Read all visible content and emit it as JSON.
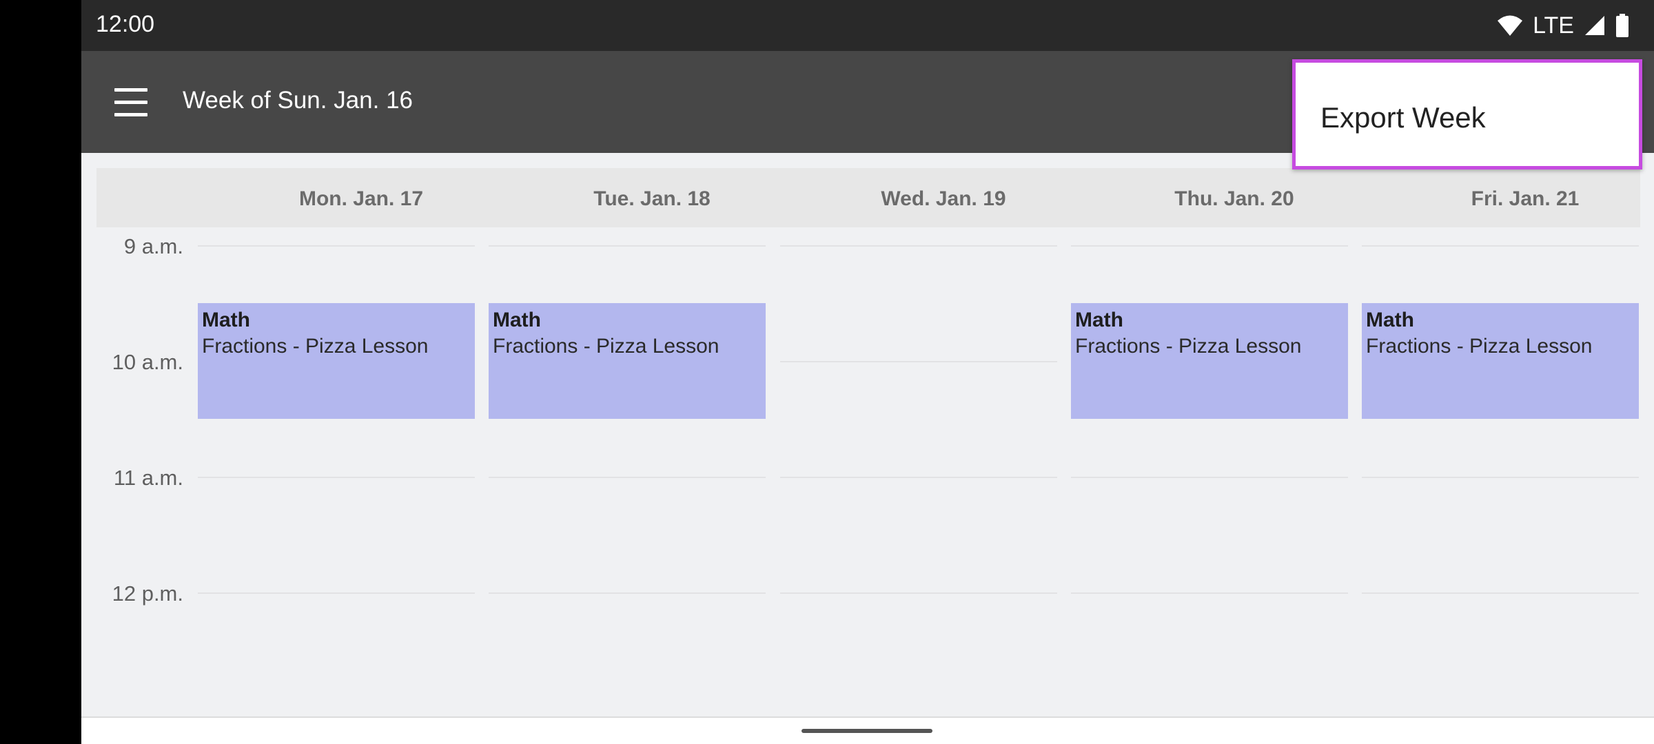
{
  "status_bar": {
    "time": "12:00",
    "network": "LTE",
    "icons": [
      "wifi-icon",
      "signal-icon",
      "battery-icon"
    ]
  },
  "toolbar": {
    "title": "Week of Sun. Jan. 16",
    "menu_icon": "hamburger-menu-icon"
  },
  "overflow_menu": {
    "items": [
      {
        "label": "Export Week"
      }
    ]
  },
  "days": [
    {
      "label": "Mon. Jan. 17"
    },
    {
      "label": "Tue. Jan. 18"
    },
    {
      "label": "Wed. Jan. 19"
    },
    {
      "label": "Thu. Jan. 20"
    },
    {
      "label": "Fri. Jan. 21"
    }
  ],
  "time_slots": [
    "9 a.m.",
    "10 a.m.",
    "11 a.m.",
    "12 p.m."
  ],
  "events": [
    {
      "day": "Mon. Jan. 17",
      "title": "Math",
      "description": "Fractions - Pizza Lesson"
    },
    {
      "day": "Tue. Jan. 18",
      "title": "Math",
      "description": "Fractions - Pizza Lesson"
    },
    {
      "day": "Thu. Jan. 20",
      "title": "Math",
      "description": "Fractions - Pizza Lesson"
    },
    {
      "day": "Fri. Jan. 21",
      "title": "Math",
      "description": "Fractions - Pizza Lesson"
    }
  ],
  "colors": {
    "status_bar": "#292929",
    "toolbar": "#474747",
    "event_fill": "#b3b7ee",
    "menu_highlight": "#c64be0",
    "background": "#f0f1f3"
  }
}
